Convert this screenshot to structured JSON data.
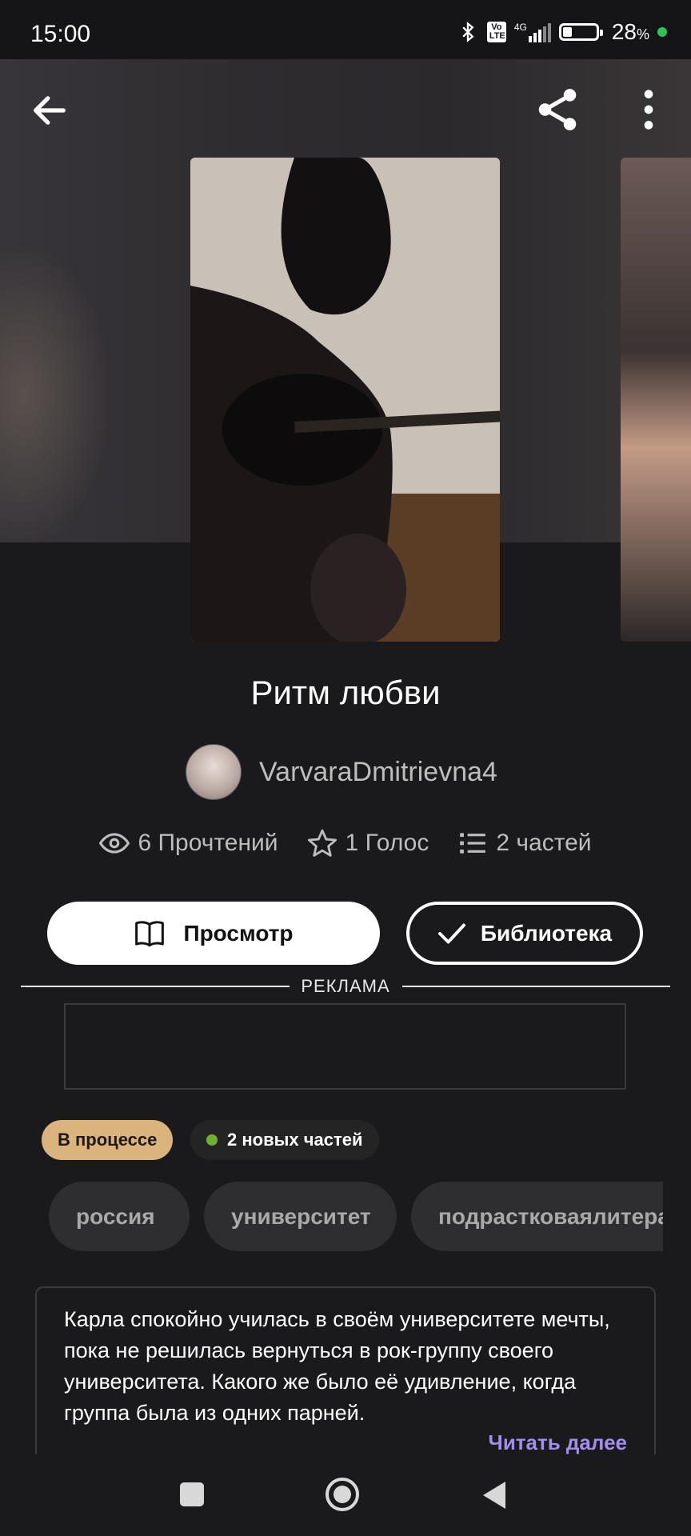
{
  "status_bar": {
    "time": "15:00",
    "battery_percent": "28",
    "battery_unit": "%",
    "battery_level": 0.28,
    "icons": [
      "bluetooth-icon",
      "volte-icon",
      "signal-4g-icon",
      "battery-icon",
      "green-dot-indicator"
    ],
    "network": "4G",
    "volte": "Vo LTE"
  },
  "header": {
    "back_icon": "arrow-left-icon",
    "share_icon": "share-icon",
    "more_icon": "more-vertical-icon"
  },
  "story": {
    "title": "Ритм любви",
    "author": "VarvaraDmitrievna4"
  },
  "stats": {
    "reads": "6 Прочтений",
    "votes": "1 Голос",
    "parts": "2 частей"
  },
  "actions": {
    "read_label": "Просмотр",
    "library_label": "Библиотека"
  },
  "ad": {
    "label": "РЕКЛАМА"
  },
  "badges": {
    "status": "В процессе",
    "new_parts": "2 новых частей"
  },
  "tags": [
    "россия",
    "университет",
    "подрастковаялитература"
  ],
  "description": {
    "text": "Карла спокойно училась в своём университете мечты, пока не решилась вернуться в рок-группу своего университета. Какого же было её удивление, когда группа была из одних парней.",
    "read_more": "Читать далее"
  },
  "colors": {
    "background": "#1a191b",
    "status_badge": "#dbb37c",
    "new_dot": "#6fb232",
    "read_more": "#a38ded",
    "tag_bg": "#2e2d30"
  }
}
